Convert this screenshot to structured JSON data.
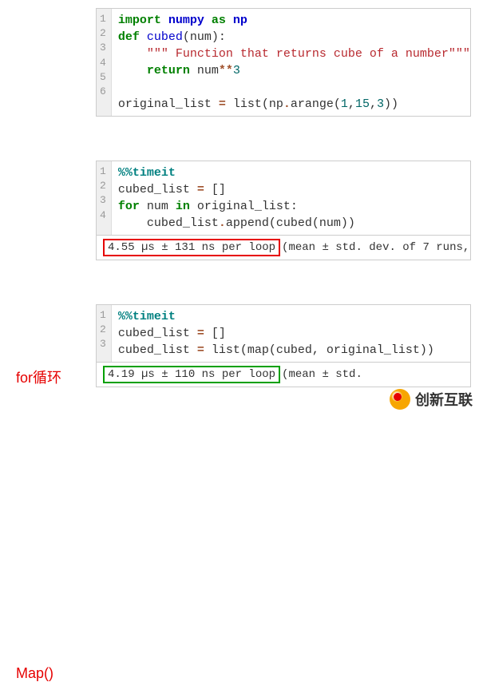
{
  "block1": {
    "ln": [
      "1",
      "2",
      "3",
      "4",
      "5",
      "6"
    ],
    "l1_kw1": "import",
    "l1_nn": "numpy",
    "l1_kw2": "as",
    "l1_al": "np",
    "l2_kw": "def",
    "l2_fn": "cubed",
    "l2_par": "(num):",
    "l3_doc": "\"\"\" Function that returns cube of a number\"\"\"",
    "l4_kw": "return",
    "l4_var": " num",
    "l4_op": "**",
    "l4_num": "3",
    "l6_var": "original_list ",
    "l6_eq": "=",
    "l6_rest": " list(np",
    "l6_dot": ".",
    "l6_ar": "arange(",
    "l6_n1": "1",
    "l6_c1": ",",
    "l6_n2": "15",
    "l6_c2": ",",
    "l6_n3": "3",
    "l6_end": "))"
  },
  "label_for": "for循环",
  "block2": {
    "ln": [
      "1",
      "2",
      "3",
      "4"
    ],
    "l1_mag": "%%timeit",
    "l2": "cubed_list ",
    "l2_eq": "=",
    "l2_rest": " []",
    "l3_kw1": "for",
    "l3_var": " num ",
    "l3_kw2": "in",
    "l3_rest": " original_list:",
    "l4_pre": "    cubed_list",
    "l4_dot": ".",
    "l4_app": "append(cubed(num))"
  },
  "timing1_boxed": "4.55 µs ± 131 ns per loop",
  "timing1_rest": " (mean ± std. dev. of 7 runs,",
  "label_map": "Map()",
  "block3": {
    "ln": [
      "1",
      "2",
      "3"
    ],
    "l1_mag": "%%timeit",
    "l2": "cubed_list ",
    "l2_eq": "=",
    "l2_rest": " []",
    "l3": "cubed_list ",
    "l3_eq": "=",
    "l3_rest": " list(map(cubed, original_list))"
  },
  "timing2_boxed": "4.19 µs ± 110 ns per loop",
  "timing2_rest": " (mean ± std.",
  "watermark": "创新互联"
}
